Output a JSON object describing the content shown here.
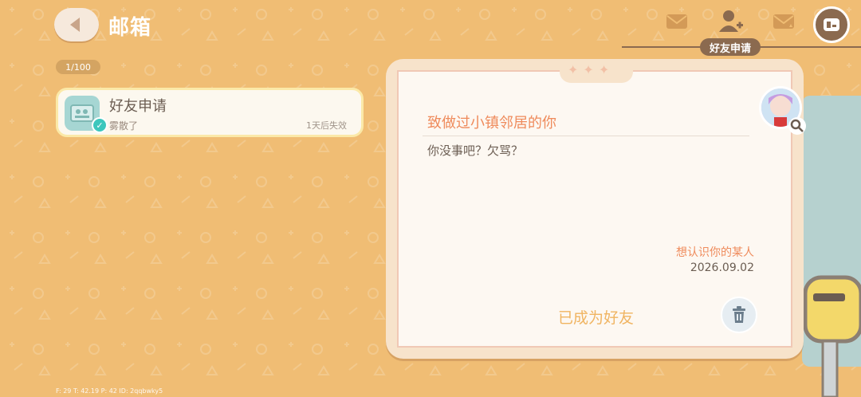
{
  "header": {
    "title": "邮箱",
    "active_tab_label": "好友申请"
  },
  "mailbox": {
    "count": "1/100",
    "items": [
      {
        "title": "好友申请",
        "sender": "雾散了",
        "expire": "1天后失效"
      }
    ]
  },
  "letter": {
    "title": "致做过小镇邻居的你",
    "body": "你没事吧？欠骂？",
    "signature": "想认识你的某人",
    "date": "2026.09.02",
    "status": "已成为好友"
  },
  "debug": {
    "text": "F: 29  T: 42.19  P: 42  ID: 2qqbwky5"
  },
  "icons": {
    "back": "back-arrow-icon",
    "mail": "mail-icon",
    "add_friend": "add-friend-icon",
    "mail_star": "mail-star-icon",
    "profile": "profile-card-icon",
    "trash": "trash-icon",
    "search": "magnifier-icon"
  },
  "colors": {
    "background": "#f0bd74",
    "accent": "#ef8b5c",
    "status": "#f0b461",
    "tab": "#8b6a4f",
    "check": "#3cc7bd"
  }
}
